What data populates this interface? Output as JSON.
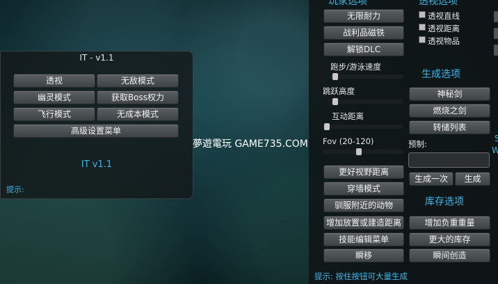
{
  "watermark": "夢遊電玩 GAME735.COM",
  "left_panel": {
    "title": "IT - v1.1",
    "buttons": [
      "透视",
      "无敌模式",
      "幽灵模式",
      "获取Boss权力",
      "飞行模式",
      "无成本模式",
      "高级设置菜单"
    ],
    "version": "IT v1.1",
    "hint": "提示:"
  },
  "right_panel": {
    "top_section_title_partial": "玩家选项",
    "xray_section_title_partial": "透视选项",
    "player_buttons": [
      "无限耐力",
      "战利品磁铁",
      "解锁DLC"
    ],
    "xray_options": [
      "透视直线",
      "透视距离",
      "透视物品"
    ],
    "sliders": [
      {
        "label": "跑步/游泳速度",
        "value": 0.05
      },
      {
        "label": "跳跃高度",
        "value": 0.05
      },
      {
        "label": "互动距离",
        "value": 0.03
      },
      {
        "label": "Fov (20-120)",
        "value": 0.45
      }
    ],
    "spawn_title": "生成选项",
    "spawn_buttons": [
      "神秘剑",
      "燃烧之剑",
      "转储列表"
    ],
    "preset_label": "预制:",
    "spawn_once": "生成一次",
    "spawn": "生成",
    "misc_buttons": [
      "更好视野距离",
      "穿墙模式",
      "驯服附近的动物",
      "增加放置或建造距离",
      "技能编辑菜单",
      "瞬移"
    ],
    "inventory_title": "库存选项",
    "inventory_buttons": [
      "增加负重重量",
      "更大的库存",
      "瞬间创造"
    ],
    "hint": "提示: 按住按钮可大量生成",
    "edge_fragments": [
      "S",
      "W"
    ]
  }
}
